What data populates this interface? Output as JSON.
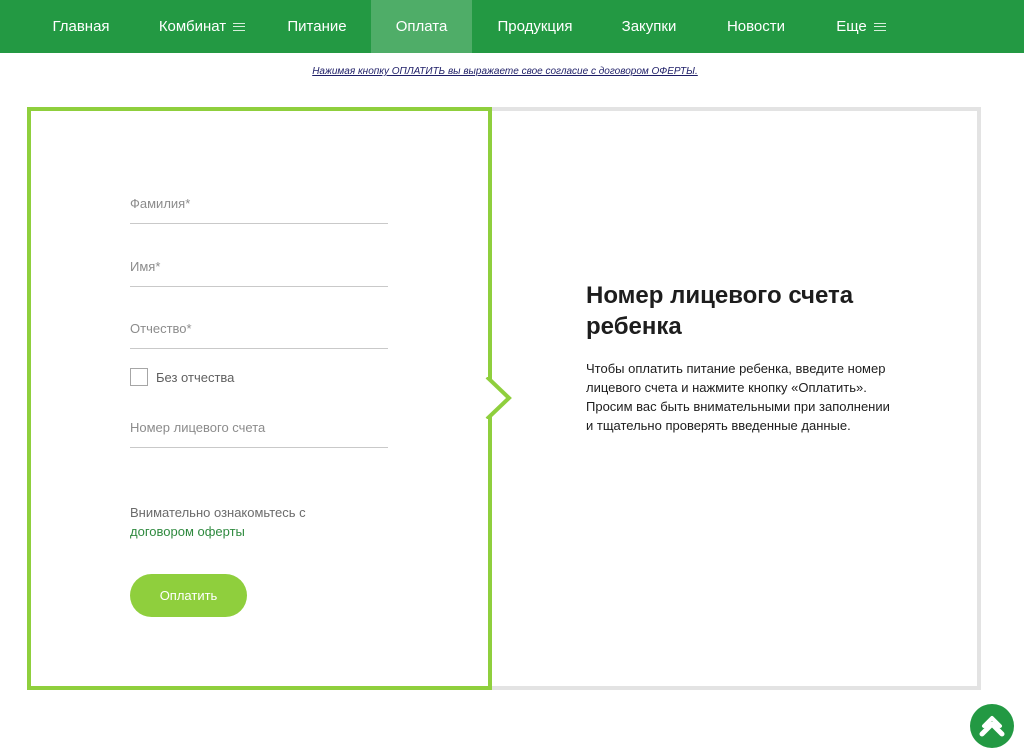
{
  "nav": {
    "items": [
      {
        "label": "Главная",
        "menu": false,
        "active": false
      },
      {
        "label": "Комбинат",
        "menu": true,
        "active": false
      },
      {
        "label": "Питание",
        "menu": false,
        "active": false
      },
      {
        "label": "Оплата",
        "menu": false,
        "active": true
      },
      {
        "label": "Продукция",
        "menu": false,
        "active": false
      },
      {
        "label": "Закупки",
        "menu": false,
        "active": false
      },
      {
        "label": "Новости",
        "menu": false,
        "active": false
      },
      {
        "label": "Еще",
        "menu": true,
        "active": false
      }
    ]
  },
  "notice": "Нажимая кнопку ОПЛАТИТЬ вы выражаете свое согласие с договором ОФЕРТЫ.",
  "form": {
    "surname_placeholder": "Фамилия*",
    "name_placeholder": "Имя*",
    "patronymic_placeholder": "Отчество*",
    "no_patronymic_label": "Без отчества",
    "no_patronymic_checked": false,
    "account_placeholder": "Номер лицевого счета",
    "terms_text": "Внимательно ознакомьтесь с",
    "terms_link": "договором оферты",
    "pay_button": "Оплатить"
  },
  "info": {
    "title": "Номер лицевого счета ребенка",
    "text": "Чтобы оплатить питание ребенка, введите номер лицевого счета и нажмите кнопку «Оплатить». Просим вас быть внимательными при заполнении и тщательно проверять введенные данные."
  },
  "icons": {
    "menu": "burger-icon",
    "scroll_top": "chevron-up-icon"
  },
  "colors": {
    "nav_bg": "#239943",
    "nav_active": "#4fad68",
    "accent_green": "#8fcf3d",
    "panel_border": "#e3e3e3",
    "link_green": "#2f8a3f"
  }
}
